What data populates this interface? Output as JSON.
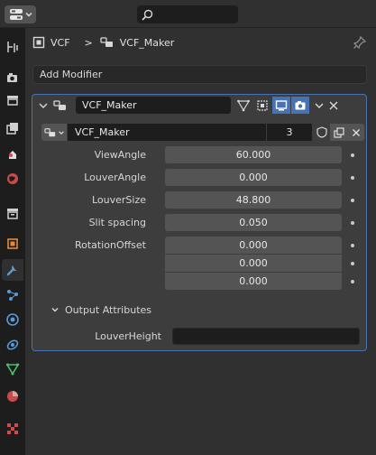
{
  "header": {
    "search_placeholder": ""
  },
  "breadcrumb": {
    "object": "VCF",
    "separator": ">",
    "modifier": "VCF_Maker"
  },
  "add_modifier_label": "Add Modifier",
  "modifier": {
    "name": "VCF_Maker",
    "node_group": {
      "name": "VCF_Maker",
      "users": "3"
    },
    "inputs": [
      {
        "label": "ViewAngle",
        "value": "60.000"
      },
      {
        "label": "LouverAngle",
        "value": "0.000"
      },
      {
        "label": "LouverSize",
        "value": "48.800"
      },
      {
        "label": "Slit spacing",
        "value": "0.050"
      }
    ],
    "rotation_offset": {
      "label": "RotationOffset",
      "values": [
        "0.000",
        "0.000",
        "0.000"
      ]
    },
    "output_section": {
      "label": "Output Attributes",
      "attributes": [
        {
          "label": "LouverHeight",
          "value": ""
        }
      ]
    }
  },
  "colors": {
    "accent": "#4772b3",
    "panel_bg": "#3d3d3d",
    "field_bg": "#545454",
    "editor_bg": "#303030"
  },
  "tab_icons": [
    "tool-icon",
    "render-icon",
    "output-icon",
    "view-layer-icon",
    "scene-icon",
    "world-icon",
    "collection-icon",
    "object-icon",
    "modifier-icon",
    "particles-icon",
    "physics-icon",
    "constraints-icon",
    "data-icon",
    "material-icon",
    "texture-icon"
  ]
}
